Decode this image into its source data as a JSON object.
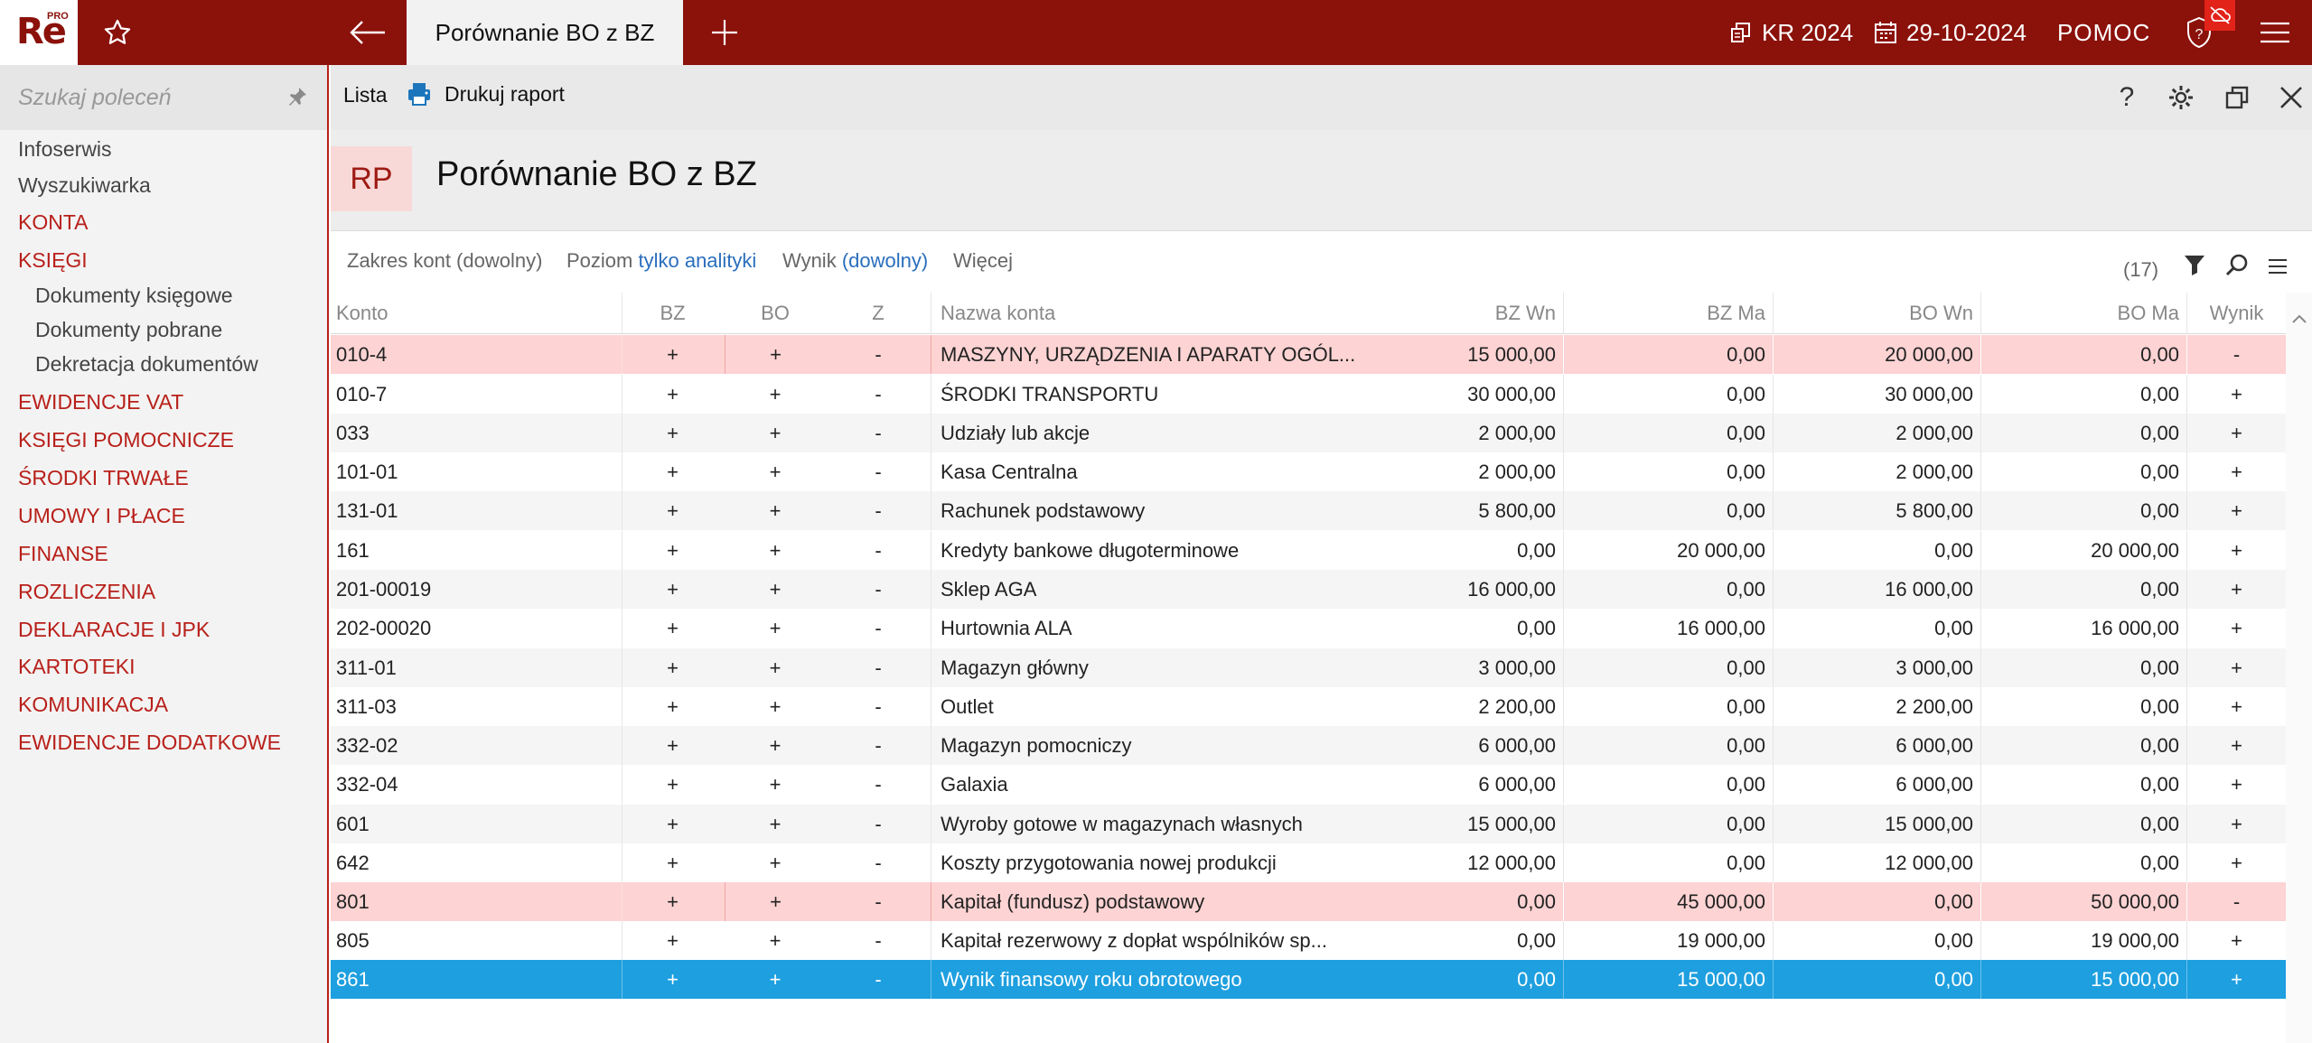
{
  "app": {
    "logo_text": "Re",
    "logo_sup": "PRO",
    "active_tab": "Porównanie BO z BZ",
    "year": "KR 2024",
    "date": "29-10-2024",
    "help": "POMOC"
  },
  "sidebar": {
    "search_placeholder": "Szukaj poleceń",
    "items": [
      {
        "label": "Infoserwis",
        "kind": "plain"
      },
      {
        "label": "Wyszukiwarka",
        "kind": "plain"
      },
      {
        "label": "KONTA",
        "kind": "cat"
      },
      {
        "label": "KSIĘGI",
        "kind": "cat"
      },
      {
        "label": "Dokumenty księgowe",
        "kind": "sub"
      },
      {
        "label": "Dokumenty pobrane",
        "kind": "sub"
      },
      {
        "label": "Dekretacja dokumentów",
        "kind": "sub"
      },
      {
        "label": "EWIDENCJE VAT",
        "kind": "cat"
      },
      {
        "label": "KSIĘGI POMOCNICZE",
        "kind": "cat"
      },
      {
        "label": "ŚRODKI TRWAŁE",
        "kind": "cat"
      },
      {
        "label": "UMOWY I PŁACE",
        "kind": "cat"
      },
      {
        "label": "FINANSE",
        "kind": "cat"
      },
      {
        "label": "ROZLICZENIA",
        "kind": "cat"
      },
      {
        "label": "DEKLARACJE I JPK",
        "kind": "cat"
      },
      {
        "label": "KARTOTEKI",
        "kind": "cat"
      },
      {
        "label": "KOMUNIKACJA",
        "kind": "cat"
      },
      {
        "label": "EWIDENCJE DODATKOWE",
        "kind": "cat"
      }
    ]
  },
  "toolbar": {
    "list_label": "Lista",
    "print_label": "Drukuj raport",
    "help_glyph": "?"
  },
  "header": {
    "badge": "RP",
    "title": "Porównanie BO z BZ"
  },
  "filters": {
    "range_label": "Zakres kont (dowolny)",
    "level_label": "Poziom",
    "level_value": "tylko analityki",
    "result_label": "Wynik",
    "result_value": "(dowolny)",
    "more_label": "Więcej",
    "count": "(17)"
  },
  "table": {
    "columns": [
      "Konto",
      "BZ",
      "BO",
      "Z",
      "Nazwa konta",
      "BZ Wn",
      "BZ Ma",
      "BO Wn",
      "BO Ma",
      "Wynik"
    ],
    "rows": [
      {
        "konto": "010-4",
        "bz": "+",
        "bo": "+",
        "z": "-",
        "nazwa": "MASZYNY, URZĄDZENIA I APARATY OGÓL...",
        "bz_wn": "15 000,00",
        "bz_ma": "0,00",
        "bo_wn": "20 000,00",
        "bo_ma": "0,00",
        "wynik": "-",
        "state": "err"
      },
      {
        "konto": "010-7",
        "bz": "+",
        "bo": "+",
        "z": "-",
        "nazwa": "ŚRODKI TRANSPORTU",
        "bz_wn": "30 000,00",
        "bz_ma": "0,00",
        "bo_wn": "30 000,00",
        "bo_ma": "0,00",
        "wynik": "+",
        "state": ""
      },
      {
        "konto": "033",
        "bz": "+",
        "bo": "+",
        "z": "-",
        "nazwa": "Udziały lub akcje",
        "bz_wn": "2 000,00",
        "bz_ma": "0,00",
        "bo_wn": "2 000,00",
        "bo_ma": "0,00",
        "wynik": "+",
        "state": "zebra"
      },
      {
        "konto": "101-01",
        "bz": "+",
        "bo": "+",
        "z": "-",
        "nazwa": "Kasa Centralna",
        "bz_wn": "2 000,00",
        "bz_ma": "0,00",
        "bo_wn": "2 000,00",
        "bo_ma": "0,00",
        "wynik": "+",
        "state": ""
      },
      {
        "konto": "131-01",
        "bz": "+",
        "bo": "+",
        "z": "-",
        "nazwa": "Rachunek podstawowy",
        "bz_wn": "5 800,00",
        "bz_ma": "0,00",
        "bo_wn": "5 800,00",
        "bo_ma": "0,00",
        "wynik": "+",
        "state": "zebra"
      },
      {
        "konto": "161",
        "bz": "+",
        "bo": "+",
        "z": "-",
        "nazwa": "Kredyty bankowe długoterminowe",
        "bz_wn": "0,00",
        "bz_ma": "20 000,00",
        "bo_wn": "0,00",
        "bo_ma": "20 000,00",
        "wynik": "+",
        "state": ""
      },
      {
        "konto": "201-00019",
        "bz": "+",
        "bo": "+",
        "z": "-",
        "nazwa": "Sklep AGA",
        "bz_wn": "16 000,00",
        "bz_ma": "0,00",
        "bo_wn": "16 000,00",
        "bo_ma": "0,00",
        "wynik": "+",
        "state": "zebra"
      },
      {
        "konto": "202-00020",
        "bz": "+",
        "bo": "+",
        "z": "-",
        "nazwa": "Hurtownia ALA",
        "bz_wn": "0,00",
        "bz_ma": "16 000,00",
        "bo_wn": "0,00",
        "bo_ma": "16 000,00",
        "wynik": "+",
        "state": ""
      },
      {
        "konto": "311-01",
        "bz": "+",
        "bo": "+",
        "z": "-",
        "nazwa": "Magazyn główny",
        "bz_wn": "3 000,00",
        "bz_ma": "0,00",
        "bo_wn": "3 000,00",
        "bo_ma": "0,00",
        "wynik": "+",
        "state": "zebra"
      },
      {
        "konto": "311-03",
        "bz": "+",
        "bo": "+",
        "z": "-",
        "nazwa": "Outlet",
        "bz_wn": "2 200,00",
        "bz_ma": "0,00",
        "bo_wn": "2 200,00",
        "bo_ma": "0,00",
        "wynik": "+",
        "state": ""
      },
      {
        "konto": "332-02",
        "bz": "+",
        "bo": "+",
        "z": "-",
        "nazwa": "Magazyn pomocniczy",
        "bz_wn": "6 000,00",
        "bz_ma": "0,00",
        "bo_wn": "6 000,00",
        "bo_ma": "0,00",
        "wynik": "+",
        "state": "zebra"
      },
      {
        "konto": "332-04",
        "bz": "+",
        "bo": "+",
        "z": "-",
        "nazwa": "Galaxia",
        "bz_wn": "6 000,00",
        "bz_ma": "0,00",
        "bo_wn": "6 000,00",
        "bo_ma": "0,00",
        "wynik": "+",
        "state": ""
      },
      {
        "konto": "601",
        "bz": "+",
        "bo": "+",
        "z": "-",
        "nazwa": "Wyroby gotowe w magazynach własnych",
        "bz_wn": "15 000,00",
        "bz_ma": "0,00",
        "bo_wn": "15 000,00",
        "bo_ma": "0,00",
        "wynik": "+",
        "state": "zebra"
      },
      {
        "konto": "642",
        "bz": "+",
        "bo": "+",
        "z": "-",
        "nazwa": "Koszty przygotowania nowej produkcji",
        "bz_wn": "12 000,00",
        "bz_ma": "0,00",
        "bo_wn": "12 000,00",
        "bo_ma": "0,00",
        "wynik": "+",
        "state": ""
      },
      {
        "konto": "801",
        "bz": "+",
        "bo": "+",
        "z": "-",
        "nazwa": "Kapitał (fundusz) podstawowy",
        "bz_wn": "0,00",
        "bz_ma": "45 000,00",
        "bo_wn": "0,00",
        "bo_ma": "50 000,00",
        "wynik": "-",
        "state": "err"
      },
      {
        "konto": "805",
        "bz": "+",
        "bo": "+",
        "z": "-",
        "nazwa": "Kapitał rezerwowy z dopłat wspólników sp...",
        "bz_wn": "0,00",
        "bz_ma": "19 000,00",
        "bo_wn": "0,00",
        "bo_ma": "19 000,00",
        "wynik": "+",
        "state": ""
      },
      {
        "konto": "861",
        "bz": "+",
        "bo": "+",
        "z": "-",
        "nazwa": "Wynik finansowy roku obrotowego",
        "bz_wn": "0,00",
        "bz_ma": "15 000,00",
        "bo_wn": "0,00",
        "bo_ma": "15 000,00",
        "wynik": "+",
        "state": "sel"
      }
    ]
  },
  "colors": {
    "brand": "#8b110b",
    "category": "#b8201a",
    "error_row": "#fdd3d3",
    "selected_row": "#1e9fdf",
    "link": "#2a6ebd"
  }
}
